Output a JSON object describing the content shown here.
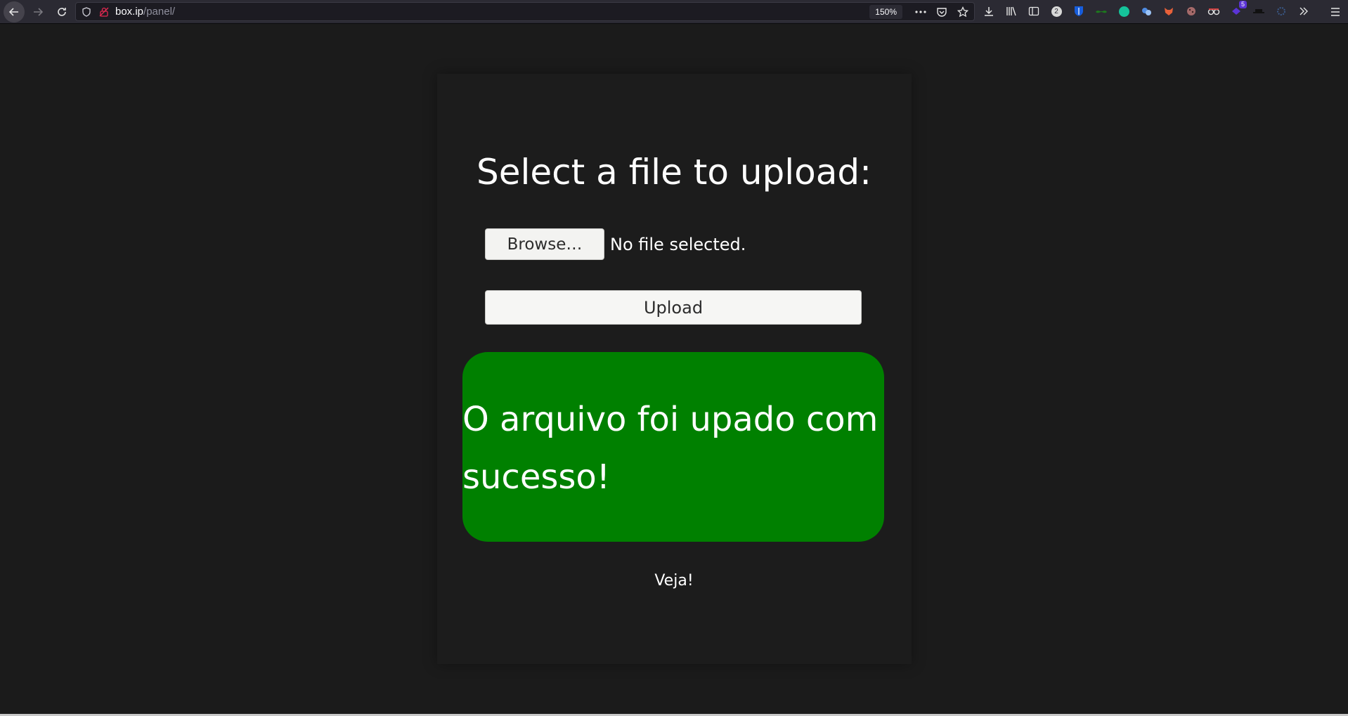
{
  "browser": {
    "url_host": "box.ip",
    "url_path": "/panel/",
    "zoom": "150%",
    "ext_badge_count": "5",
    "ext_counter": "2"
  },
  "page": {
    "title": "Select a file to upload:",
    "browse_label": "Browse…",
    "file_status": "No file selected.",
    "upload_label": "Upload",
    "success_message": "O arquivo foi upado com sucesso!",
    "veja_link": "Veja!"
  },
  "colors": {
    "background": "#1b1b1b",
    "success_bg": "#008000",
    "button_bg": "#f3f3f1"
  }
}
